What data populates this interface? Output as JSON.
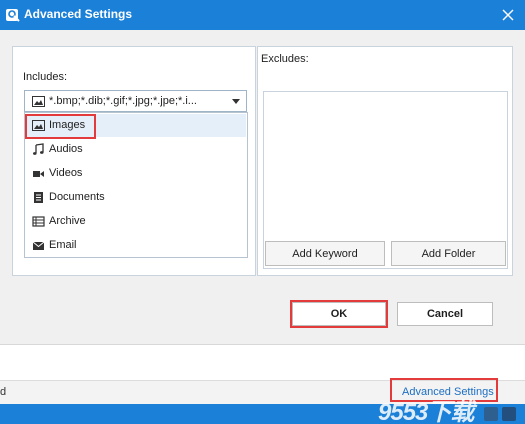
{
  "titlebar": {
    "title": "Advanced Settings",
    "close_icon": "close-icon"
  },
  "includes": {
    "label": "Includes:",
    "selected_value": "*.bmp;*.dib;*.gif;*.jpg;*.jpe;*.i...",
    "options": [
      {
        "label": "Images",
        "icon": "image-icon"
      },
      {
        "label": "Audios",
        "icon": "music-note-icon"
      },
      {
        "label": "Videos",
        "icon": "video-camera-icon"
      },
      {
        "label": "Documents",
        "icon": "document-icon"
      },
      {
        "label": "Archive",
        "icon": "archive-icon"
      },
      {
        "label": "Email",
        "icon": "envelope-icon"
      }
    ]
  },
  "excludes": {
    "label": "Excludes:",
    "add_keyword": "Add Keyword",
    "add_folder": "Add Folder"
  },
  "actions": {
    "ok": "OK",
    "cancel": "Cancel"
  },
  "background": {
    "status_fragment": "d",
    "advanced_settings_link": "Advanced Settings",
    "watermark": "9553下载"
  },
  "colors": {
    "titlebar": "#1a80d8",
    "highlight": "#e33b3b",
    "link": "#1d6fc2",
    "selected_item": "#e5eff9"
  }
}
